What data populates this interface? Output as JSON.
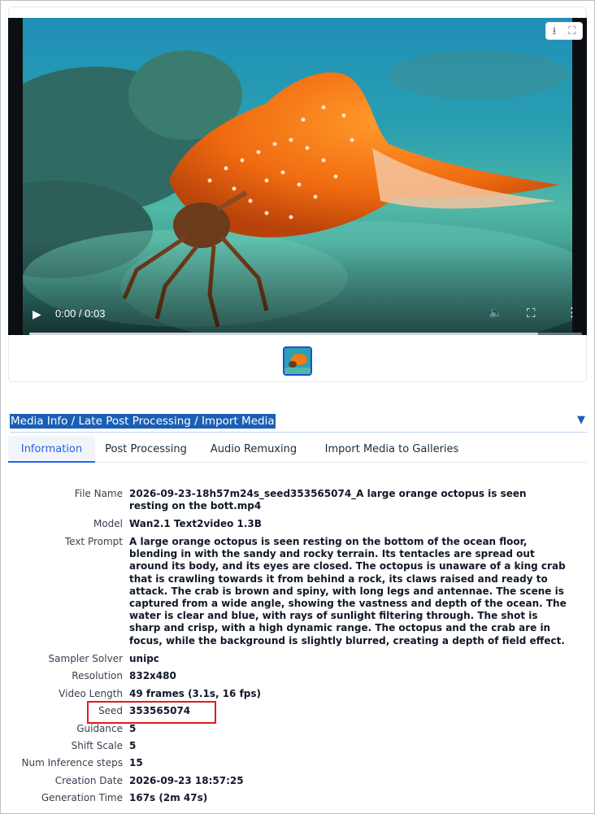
{
  "video": {
    "time_display": "0:00 / 0:03",
    "progress_fraction": 0.92,
    "play_icon": "play-icon",
    "mute_icon": "volume-icon",
    "fullscreen_icon": "fullscreen-icon",
    "more_icon": "more-vertical-icon",
    "download_icon": "download-icon",
    "expand_icon": "expand-icon"
  },
  "accordion": {
    "title": "Media Info / Late Post Processing / Import Media",
    "caret": "▼"
  },
  "tabs": [
    {
      "label": "Information",
      "active": true
    },
    {
      "label": "Post Processing",
      "active": false
    },
    {
      "label": "Audio Remuxing",
      "active": false
    },
    {
      "label": "Import Media to Galleries",
      "active": false
    }
  ],
  "info": {
    "file_name_label": "File Name",
    "file_name": "2026-09-23-18h57m24s_seed353565074_A large orange octopus is seen resting on the bott.mp4",
    "model_label": "Model",
    "model": "Wan2.1 Text2video 1.3B",
    "prompt_label": "Text Prompt",
    "prompt": "A large orange octopus is seen resting on the bottom of the ocean floor, blending in with the sandy and rocky terrain. Its tentacles are spread out around its body, and its eyes are closed. The octopus is unaware of a king crab that is crawling towards it from behind a rock, its claws raised and ready to attack. The crab is brown and spiny, with long legs and antennae. The scene is captured from a wide angle, showing the vastness and depth of the ocean. The water is clear and blue, with rays of sunlight filtering through. The shot is sharp and crisp, with a high dynamic range. The octopus and the crab are in focus, while the background is slightly blurred, creating a depth of field effect.",
    "sampler_label": "Sampler Solver",
    "sampler": "unipc",
    "resolution_label": "Resolution",
    "resolution": "832x480",
    "video_length_label": "Video Length",
    "video_length": "49 frames (3.1s, 16 fps)",
    "seed_label": "Seed",
    "seed": "353565074",
    "guidance_label": "Guidance",
    "guidance": "5",
    "shift_label": "Shift Scale",
    "shift": "5",
    "steps_label": "Num Inference steps",
    "steps": "15",
    "creation_label": "Creation Date",
    "creation": "2026-09-23 18:57:25",
    "gentime_label": "Generation Time",
    "gentime": "167s (2m 47s)"
  },
  "colors": {
    "accent": "#2563eb",
    "header_highlight": "#1a5fb4",
    "seed_box": "#e11d1d"
  }
}
